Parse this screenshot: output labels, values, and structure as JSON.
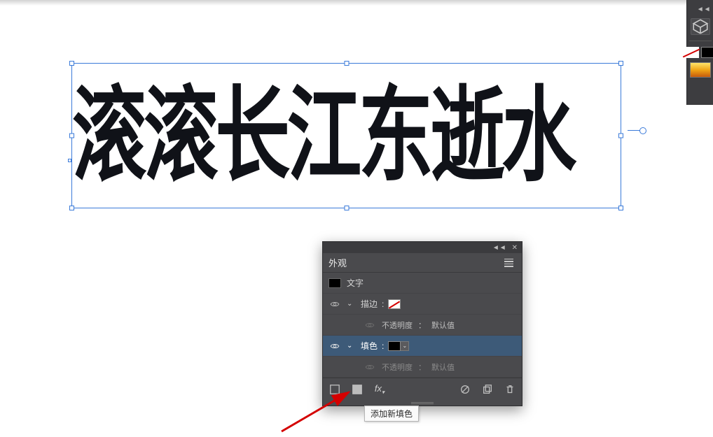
{
  "canvas": {
    "text": "滚滚长江东逝水"
  },
  "panel": {
    "tab_label": "外观",
    "type_label": "文字",
    "stroke_label": "描边",
    "fill_label": "填色",
    "opacity_label": "不透明度",
    "opacity_value": "默认值",
    "opacity_sep": "："
  },
  "tooltip": {
    "text": "添加新填色"
  },
  "controls": {
    "collapse_glyph": "◄◄",
    "close_glyph": "✕",
    "caret_down": "⌄",
    "twisty_open": "⌄"
  }
}
